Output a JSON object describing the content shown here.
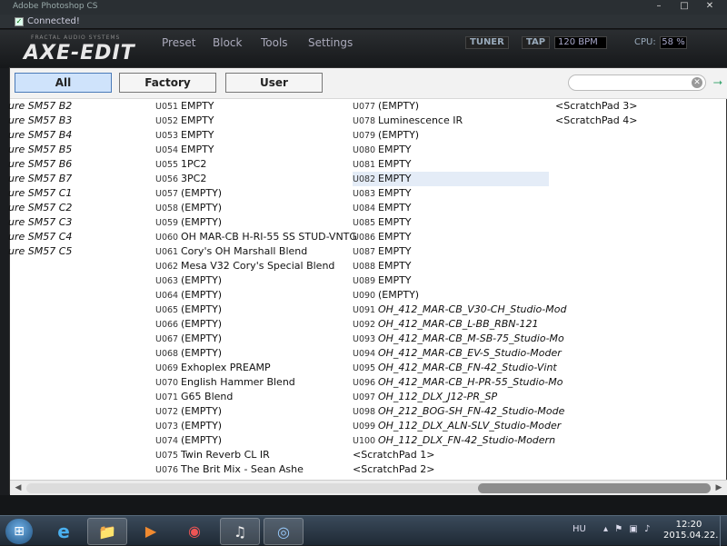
{
  "window": {
    "title": "Adobe Photoshop CS",
    "min": "–",
    "max": "□",
    "close": "✕"
  },
  "connection": {
    "checked": "✓",
    "label": "Connected!"
  },
  "app": {
    "logo_small": "FRACTAL AUDIO SYSTEMS",
    "logo": "AXE-EDIT",
    "menu": [
      "Preset",
      "Block",
      "Tools",
      "Settings"
    ],
    "tuner": "TUNER",
    "tap": "TAP",
    "bpm": "120 BPM",
    "cpu_label": "CPU:",
    "cpu_value": "58 %"
  },
  "filters": {
    "all": "All",
    "factory": "Factory",
    "user": "User"
  },
  "search": {
    "placeholder": "",
    "clear_icon": "✕",
    "pin_icon": "⭢"
  },
  "columns": {
    "a": [
      "ure SM57 B2",
      "ure SM57 B3",
      "ure SM57 B4",
      "ure SM57 B5",
      "ure SM57 B6",
      "ure SM57 B7",
      "ure SM57 C1",
      "ure SM57 C2",
      "ure SM57 C3",
      "ure SM57 C4",
      "ure SM57 C5"
    ],
    "b": [
      {
        "num": "U051",
        "name": "EMPTY"
      },
      {
        "num": "U052",
        "name": "EMPTY"
      },
      {
        "num": "U053",
        "name": "EMPTY"
      },
      {
        "num": "U054",
        "name": "EMPTY"
      },
      {
        "num": "U055",
        "name": "1PC2"
      },
      {
        "num": "U056",
        "name": "3PC2"
      },
      {
        "num": "U057",
        "name": "(EMPTY)"
      },
      {
        "num": "U058",
        "name": "(EMPTY)"
      },
      {
        "num": "U059",
        "name": "(EMPTY)"
      },
      {
        "num": "U060",
        "name": "OH MAR-CB H-RI-55 SS STUD-VNTG"
      },
      {
        "num": "U061",
        "name": "Cory's OH Marshall Blend"
      },
      {
        "num": "U062",
        "name": "Mesa V32 Cory's Special Blend"
      },
      {
        "num": "U063",
        "name": "(EMPTY)"
      },
      {
        "num": "U064",
        "name": "(EMPTY)"
      },
      {
        "num": "U065",
        "name": "(EMPTY)"
      },
      {
        "num": "U066",
        "name": "(EMPTY)"
      },
      {
        "num": "U067",
        "name": "(EMPTY)"
      },
      {
        "num": "U068",
        "name": "(EMPTY)"
      },
      {
        "num": "U069",
        "name": "Exhoplex PREAMP"
      },
      {
        "num": "U070",
        "name": "English Hammer Blend"
      },
      {
        "num": "U071",
        "name": "G65 Blend"
      },
      {
        "num": "U072",
        "name": "(EMPTY)"
      },
      {
        "num": "U073",
        "name": "(EMPTY)"
      },
      {
        "num": "U074",
        "name": "(EMPTY)"
      },
      {
        "num": "U075",
        "name": "Twin Reverb CL IR"
      },
      {
        "num": "U076",
        "name": "The Brit Mix - Sean Ashe"
      }
    ],
    "c": [
      {
        "num": "U077",
        "name": "(EMPTY)"
      },
      {
        "num": "U078",
        "name": "Luminescence IR"
      },
      {
        "num": "U079",
        "name": "(EMPTY)"
      },
      {
        "num": "U080",
        "name": "EMPTY"
      },
      {
        "num": "U081",
        "name": "EMPTY"
      },
      {
        "num": "U082",
        "name": "EMPTY"
      },
      {
        "num": "U083",
        "name": "EMPTY"
      },
      {
        "num": "U084",
        "name": "EMPTY"
      },
      {
        "num": "U085",
        "name": "EMPTY"
      },
      {
        "num": "U086",
        "name": "EMPTY"
      },
      {
        "num": "U087",
        "name": "EMPTY"
      },
      {
        "num": "U088",
        "name": "EMPTY"
      },
      {
        "num": "U089",
        "name": "EMPTY"
      },
      {
        "num": "U090",
        "name": "(EMPTY)"
      },
      {
        "num": "U091",
        "name": "OH_412_MAR-CB_V30-CH_Studio-Mod"
      },
      {
        "num": "U092",
        "name": "OH_412_MAR-CB_L-BB_RBN-121"
      },
      {
        "num": "U093",
        "name": "OH_412_MAR-CB_M-SB-75_Studio-Mo"
      },
      {
        "num": "U094",
        "name": "OH_412_MAR-CB_EV-S_Studio-Moder"
      },
      {
        "num": "U095",
        "name": "OH_412_MAR-CB_FN-42_Studio-Vint"
      },
      {
        "num": "U096",
        "name": "OH_412_MAR-CB_H-PR-55_Studio-Mo"
      },
      {
        "num": "U097",
        "name": "OH_112_DLX_J12-PR_SP"
      },
      {
        "num": "U098",
        "name": "OH_212_BOG-SH_FN-42_Studio-Mode"
      },
      {
        "num": "U099",
        "name": "OH_112_DLX_ALN-SLV_Studio-Moder"
      },
      {
        "num": "U100",
        "name": "OH_112_DLX_FN-42_Studio-Modern"
      },
      {
        "num": "",
        "name": "<ScratchPad 1>"
      },
      {
        "num": "",
        "name": "<ScratchPad 2>"
      }
    ],
    "d": [
      {
        "num": "",
        "name": "<ScratchPad 3>"
      },
      {
        "num": "",
        "name": "<ScratchPad 4>"
      }
    ]
  },
  "selected_slot": "U082",
  "scroll": {
    "left": "◀",
    "right": "▶"
  },
  "taskbar": {
    "start_icon": "⊞",
    "items": [
      {
        "icon": "ie-icon",
        "glyph": "e"
      },
      {
        "icon": "folder-icon",
        "glyph": "📁"
      },
      {
        "icon": "media-player-icon",
        "glyph": "▶"
      },
      {
        "icon": "chrome-icon",
        "glyph": "◉"
      },
      {
        "icon": "axe-edit-icon",
        "glyph": "♫"
      },
      {
        "icon": "photoshop-icon",
        "glyph": "◎"
      }
    ],
    "lang": "HU",
    "tray_icons": "▴ ⚑ ▣ ♪",
    "time": "12:20",
    "date": "2015.04.22."
  },
  "colors": {
    "accent": "#cfe3fb",
    "selected_row": "#e4ecf7"
  }
}
